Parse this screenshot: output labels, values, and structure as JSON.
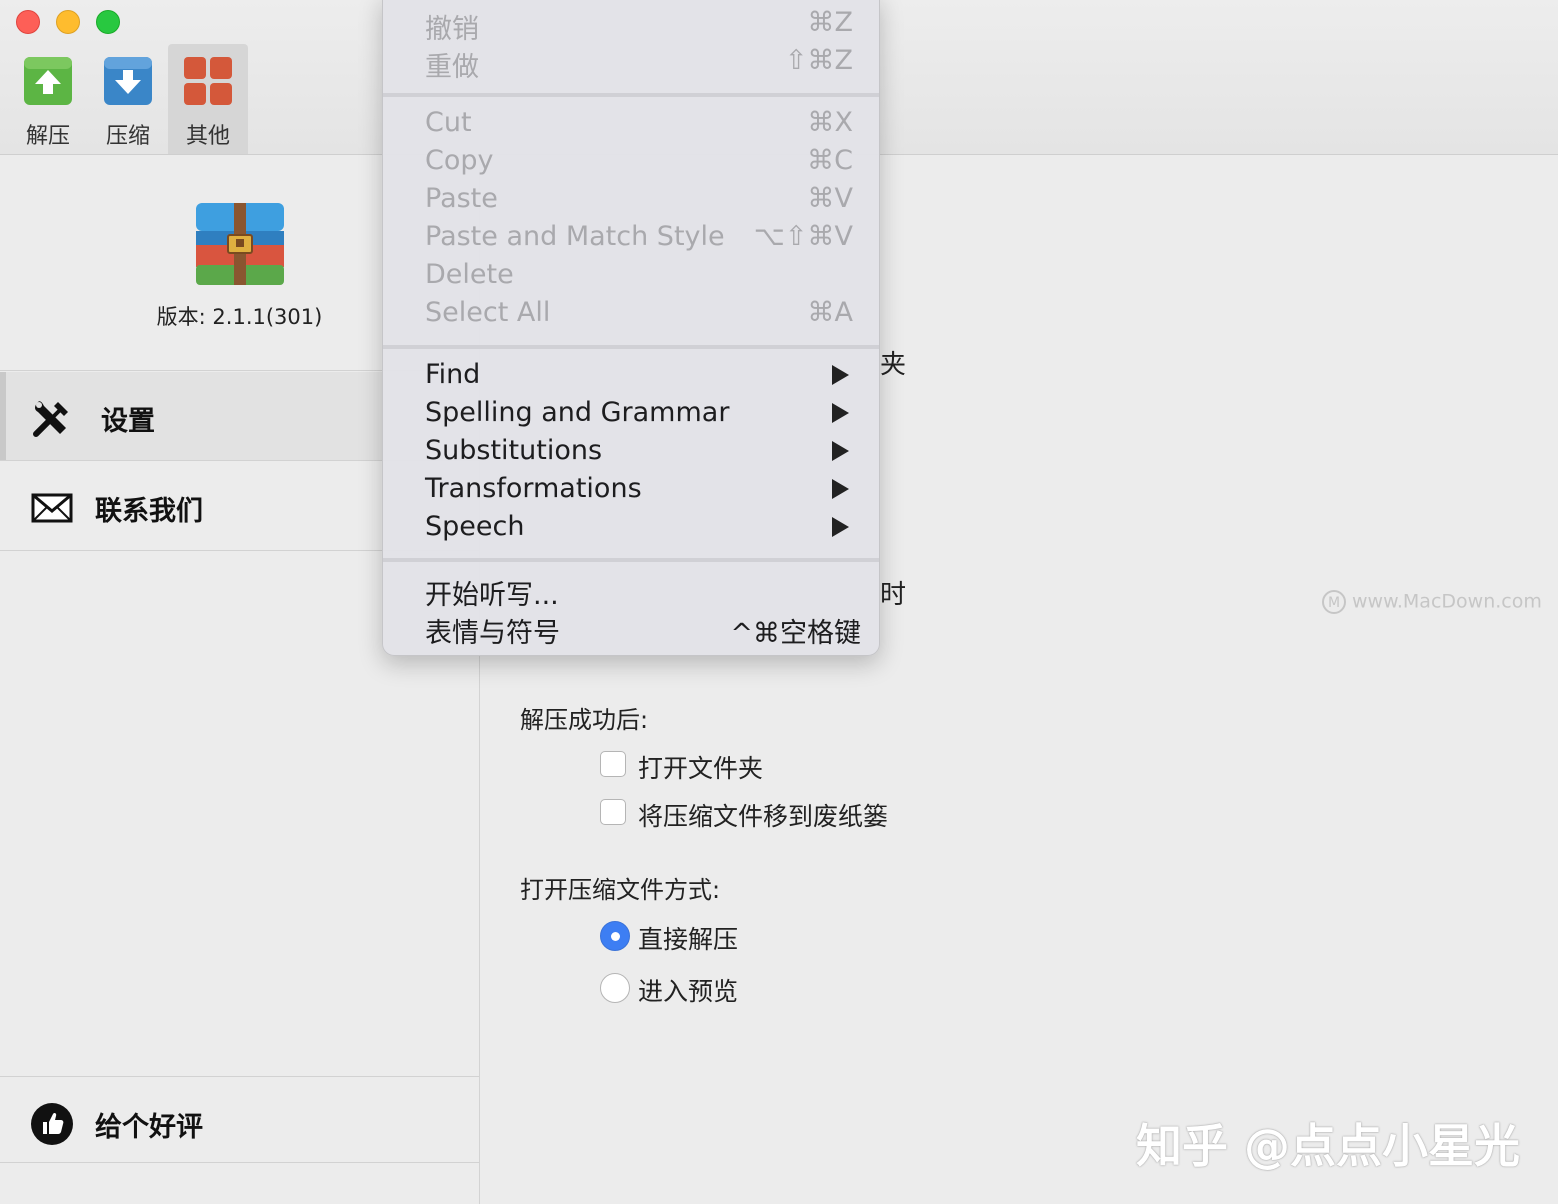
{
  "toolbar": {
    "extract_label": "解压",
    "compress_label": "压缩",
    "other_label": "其他"
  },
  "sidebar": {
    "version": "版本: 2.1.1(301)",
    "items": [
      {
        "label": "设置",
        "icon": "tools-icon",
        "selected": true
      },
      {
        "label": "联系我们",
        "icon": "envelope-icon",
        "selected": false
      }
    ],
    "rate_label": "给个好评"
  },
  "main": {
    "fragment_folder": "夹",
    "fragment_time": "时",
    "after_extract": {
      "title": "解压成功后:",
      "options": [
        {
          "label": "打开文件夹",
          "checked": false
        },
        {
          "label": "将压缩文件移到废纸篓",
          "checked": false
        }
      ]
    },
    "open_mode": {
      "title": "打开压缩文件方式:",
      "options": [
        {
          "label": "直接解压",
          "selected": true
        },
        {
          "label": "进入预览",
          "selected": false
        }
      ]
    }
  },
  "context_menu": {
    "undo": {
      "label": "撤销",
      "shortcut": "⌘Z"
    },
    "redo": {
      "label": "重做",
      "shortcut": "⇧⌘Z"
    },
    "cut": {
      "label": "Cut",
      "shortcut": "⌘X"
    },
    "copy": {
      "label": "Copy",
      "shortcut": "⌘C"
    },
    "paste": {
      "label": "Paste",
      "shortcut": "⌘V"
    },
    "paste_match": {
      "label": "Paste and Match Style",
      "shortcut": "⌥⇧⌘V"
    },
    "delete": {
      "label": "Delete"
    },
    "select_all": {
      "label": "Select All",
      "shortcut": "⌘A"
    },
    "find": {
      "label": "Find"
    },
    "spelling": {
      "label": "Spelling and Grammar"
    },
    "substitutions": {
      "label": "Substitutions"
    },
    "transformations": {
      "label": "Transformations"
    },
    "speech": {
      "label": "Speech"
    },
    "dictation": {
      "label": "开始听写..."
    },
    "emoji": {
      "label": "表情与符号",
      "shortcut": "^⌘空格键"
    }
  },
  "watermarks": {
    "site": "www.MacDown.com",
    "site_mark": "M",
    "author": "知乎 @点点小星光"
  },
  "colors": {
    "extract_green": "#5cb544",
    "compress_blue": "#3a86c8",
    "other_red": "#d4583a",
    "radio_blue": "#3d7ef3"
  }
}
